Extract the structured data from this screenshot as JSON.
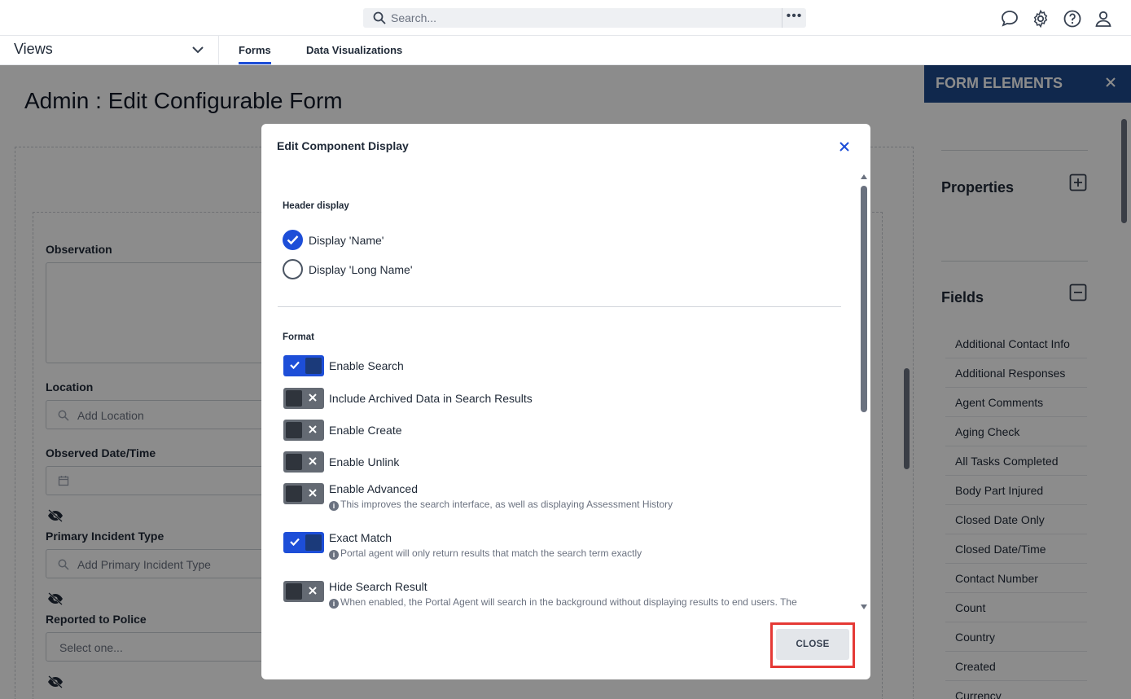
{
  "topbar": {
    "search_placeholder": "Search...",
    "more_label": "•••"
  },
  "views_bar": {
    "views_label": "Views",
    "tabs": [
      {
        "label": "Forms",
        "active": true
      },
      {
        "label": "Data Visualizations",
        "active": false
      }
    ]
  },
  "page": {
    "title": "Admin : Edit Configurable Form"
  },
  "form": {
    "fields": [
      {
        "label": "Observation",
        "type": "textarea",
        "placeholder": ""
      },
      {
        "label": "Location",
        "type": "search",
        "placeholder": "Add Location"
      },
      {
        "label": "Observed Date/Time",
        "type": "date",
        "placeholder": ""
      },
      {
        "label": "Primary Incident Type",
        "type": "search",
        "placeholder": "Add Primary Incident Type"
      },
      {
        "label": "Reported to Police",
        "type": "select",
        "placeholder": "Select one..."
      }
    ]
  },
  "right_panel": {
    "title": "FORM ELEMENTS",
    "properties_title": "Properties",
    "fields_title": "Fields",
    "field_items": [
      "Additional Contact Info",
      "Additional Responses",
      "Agent Comments",
      "Aging Check",
      "All Tasks Completed",
      "Body Part Injured",
      "Closed Date Only",
      "Closed Date/Time",
      "Contact Number",
      "Count",
      "Country",
      "Created",
      "Currency"
    ]
  },
  "modal": {
    "title": "Edit Component Display",
    "header_display_label": "Header display",
    "header_options": [
      {
        "label": "Display 'Name'",
        "checked": true
      },
      {
        "label": "Display 'Long Name'",
        "checked": false
      }
    ],
    "format_label": "Format",
    "toggles": [
      {
        "label": "Enable Search",
        "on": true,
        "help": ""
      },
      {
        "label": "Include Archived Data in Search Results",
        "on": false,
        "help": ""
      },
      {
        "label": "Enable Create",
        "on": false,
        "help": ""
      },
      {
        "label": "Enable Unlink",
        "on": false,
        "help": ""
      },
      {
        "label": "Enable Advanced",
        "on": false,
        "help": "This improves the search interface, as well as displaying Assessment History"
      },
      {
        "label": "Exact Match",
        "on": true,
        "help": "Portal agent will only return results that match the search term exactly"
      },
      {
        "label": "Hide Search Result",
        "on": false,
        "help": "When enabled, the Portal Agent will search in the background without displaying results to end users. The"
      }
    ],
    "close_label": "CLOSE"
  },
  "colors": {
    "accent": "#1d4ed8",
    "panel_header": "#1e4a8c",
    "highlight": "#e53935"
  }
}
